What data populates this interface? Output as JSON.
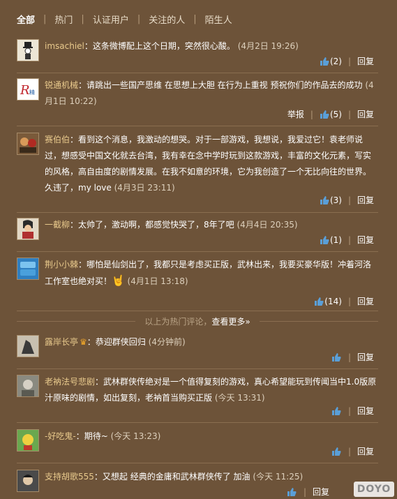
{
  "tabs": [
    {
      "label": "全部",
      "active": true
    },
    {
      "label": "热门"
    },
    {
      "label": "认证用户"
    },
    {
      "label": "关注的人"
    },
    {
      "label": "陌生人"
    }
  ],
  "hot_comments": [
    {
      "user": "imsachiel",
      "text": "这条微博配上这个日期，突然很心酸。",
      "time": "(4月2日 19:26)",
      "likes": "(2)",
      "reply": "回复"
    },
    {
      "user": "锐通机械",
      "text": "请跳出一些国产思维 在思想上大胆 在行为上重视 预祝你们的作品去的成功",
      "time": "(4月1日 10:22)",
      "likes": "(5)",
      "reply": "回复",
      "report": "举报"
    },
    {
      "user": "赛伯伯",
      "text": "看到这个消息，我激动的想哭。对于一部游戏，我想说，我爱过它！袁老师说过，想感受中国文化就去台湾，我有幸在念中学时玩到这款游戏，丰富的文化元素，写实的风格，高自由度的剧情发展。在我不如意的环境，它为我创造了一个无比向往的世界。久违了，my love",
      "time": "(4月3日 23:11)",
      "likes": "(3)",
      "reply": "回复"
    },
    {
      "user": "一截柳",
      "text": "太帅了，激动啊，都感觉快哭了，8年了吧",
      "time": "(4月4日 20:35)",
      "likes": "(1)",
      "reply": "回复"
    },
    {
      "user": "荆小小棘",
      "text": "哪怕是仙剑出了，我都只是考虑买正版，武林出来，我要买豪华版！冲着河洛工作室也绝对买！",
      "time": "(4月1日 13:18)",
      "likes": "(14)",
      "reply": "回复"
    }
  ],
  "divider": {
    "text": "以上为热门评论，",
    "more": "查看更多»"
  },
  "recent_comments": [
    {
      "user": "露岸长亭",
      "text": "恭迎群侠回归",
      "time": "(4分钟前)",
      "reply": "回复"
    },
    {
      "user": "老衲法号悲剧",
      "text": "武林群侠传绝对是一个值得复刻的游戏，真心希望能玩到传闻当中1.0版原汁原味的剧情，如出复刻，老衲首当购买正版",
      "time": "(今天 13:31)",
      "reply": "回复"
    },
    {
      "user": "-好吃鬼-",
      "text": "期待~",
      "time": "(今天 13:23)",
      "reply": "回复"
    },
    {
      "user": "支持胡歌555",
      "text": "又想起 经典的金庸和武林群侠传了 加油",
      "time": "(今天 11:25)",
      "reply": "回复"
    }
  ],
  "watermark": "DOYO",
  "colors": {
    "background": "#6d5339",
    "username": "#e8c98c",
    "like_icon": "#5a9fd8"
  }
}
